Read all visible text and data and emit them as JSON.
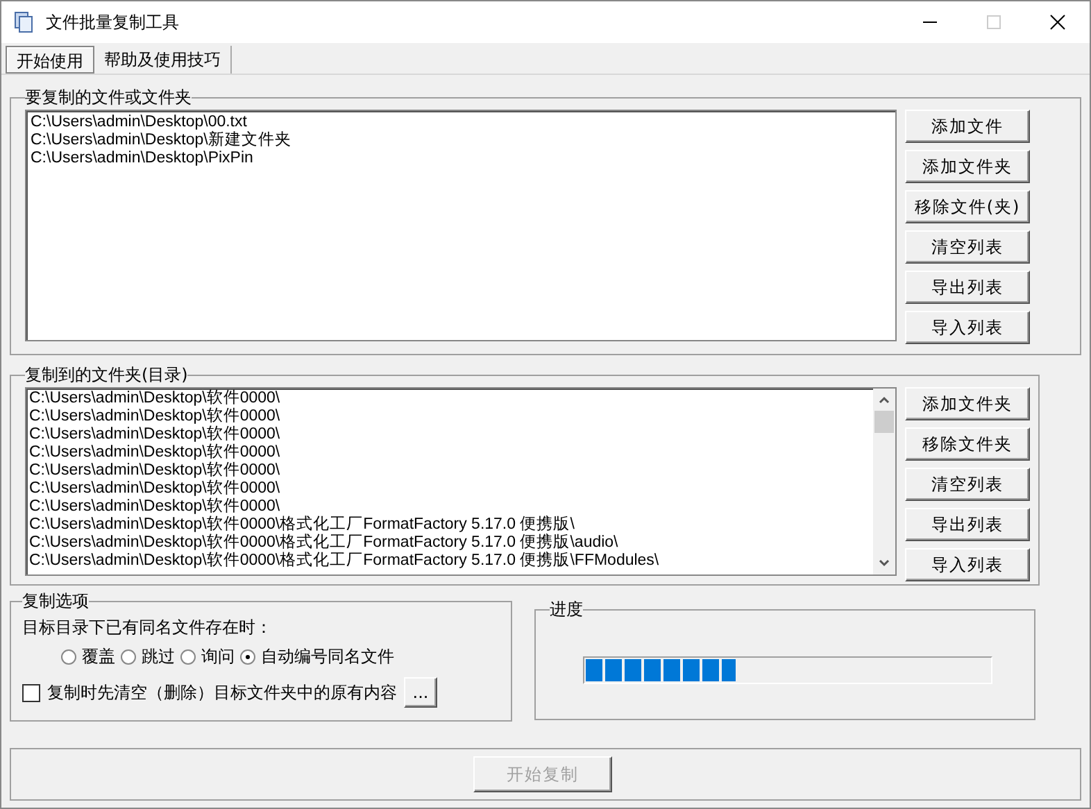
{
  "window": {
    "title": "文件批量复制工具"
  },
  "tabs": [
    {
      "label": "开始使用",
      "selected": true
    },
    {
      "label": "帮助及使用技巧",
      "selected": false
    }
  ],
  "source_group": {
    "title": "要复制的文件或文件夹",
    "items": [
      "C:\\Users\\admin\\Desktop\\00.txt",
      "C:\\Users\\admin\\Desktop\\新建文件夹",
      "C:\\Users\\admin\\Desktop\\PixPin"
    ],
    "buttons": [
      "添加文件",
      "添加文件夹",
      "移除文件(夹)",
      "清空列表",
      "导出列表",
      "导入列表"
    ]
  },
  "target_group": {
    "title": "复制到的文件夹(目录)",
    "items": [
      "C:\\Users\\admin\\Desktop\\软件0000\\",
      "C:\\Users\\admin\\Desktop\\软件0000\\",
      "C:\\Users\\admin\\Desktop\\软件0000\\",
      "C:\\Users\\admin\\Desktop\\软件0000\\",
      "C:\\Users\\admin\\Desktop\\软件0000\\",
      "C:\\Users\\admin\\Desktop\\软件0000\\",
      "C:\\Users\\admin\\Desktop\\软件0000\\",
      "C:\\Users\\admin\\Desktop\\软件0000\\格式化工厂FormatFactory 5.17.0 便携版\\",
      "C:\\Users\\admin\\Desktop\\软件0000\\格式化工厂FormatFactory 5.17.0 便携版\\audio\\",
      "C:\\Users\\admin\\Desktop\\软件0000\\格式化工厂FormatFactory 5.17.0 便携版\\FFModules\\"
    ],
    "buttons": [
      "添加文件夹",
      "移除文件夹",
      "清空列表",
      "导出列表",
      "导入列表"
    ]
  },
  "options_group": {
    "title": "复制选项",
    "prompt": "目标目录下已有同名文件存在时：",
    "radios": [
      {
        "label": "覆盖",
        "selected": false
      },
      {
        "label": "跳过",
        "selected": false
      },
      {
        "label": "询问",
        "selected": false
      },
      {
        "label": "自动编号同名文件",
        "selected": true
      }
    ],
    "clear_option": {
      "label": "复制时先清空（删除）目标文件夹中的原有内容",
      "checked": false
    },
    "more_button": "..."
  },
  "progress_group": {
    "title": "进度",
    "level": 0.37
  },
  "start_button": {
    "label": "开始复制",
    "disabled": true
  }
}
